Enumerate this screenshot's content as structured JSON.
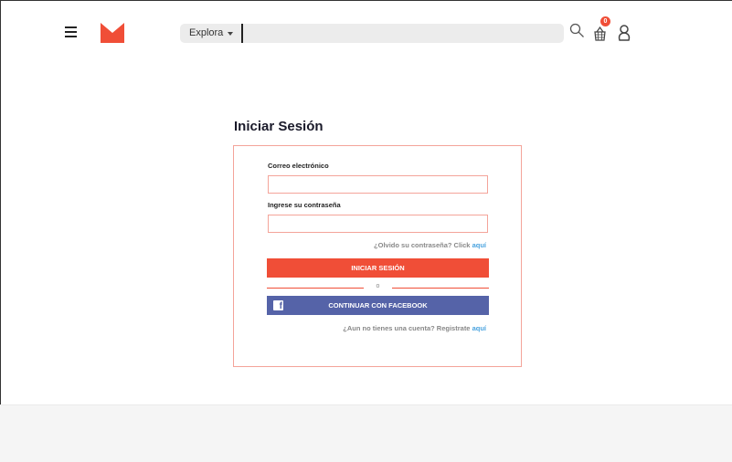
{
  "header": {
    "explora_label": "Explora",
    "search_placeholder": "",
    "cart_count": "0"
  },
  "login": {
    "title": "Iniciar Sesión",
    "email_label": "Correo electrónico",
    "email_value": "",
    "password_label": "Ingrese su contraseña",
    "password_value": "",
    "forgot_text": "¿Olvido su contraseña? Click",
    "forgot_link": "aquí",
    "submit_label": "INICIAR SESIÓN",
    "or_text": "o",
    "facebook_label": "CONTINUAR CON FACEBOOK",
    "register_text": "¿Aun no tienes una cuenta? Registrate",
    "register_link": "aquí"
  },
  "colors": {
    "brand": "#f04e37",
    "facebook": "#5563a8",
    "link": "#4aa3df"
  },
  "icons": [
    "menu-icon",
    "logo",
    "chevron-down-icon",
    "search-icon",
    "cart-icon",
    "user-icon",
    "facebook-icon"
  ]
}
